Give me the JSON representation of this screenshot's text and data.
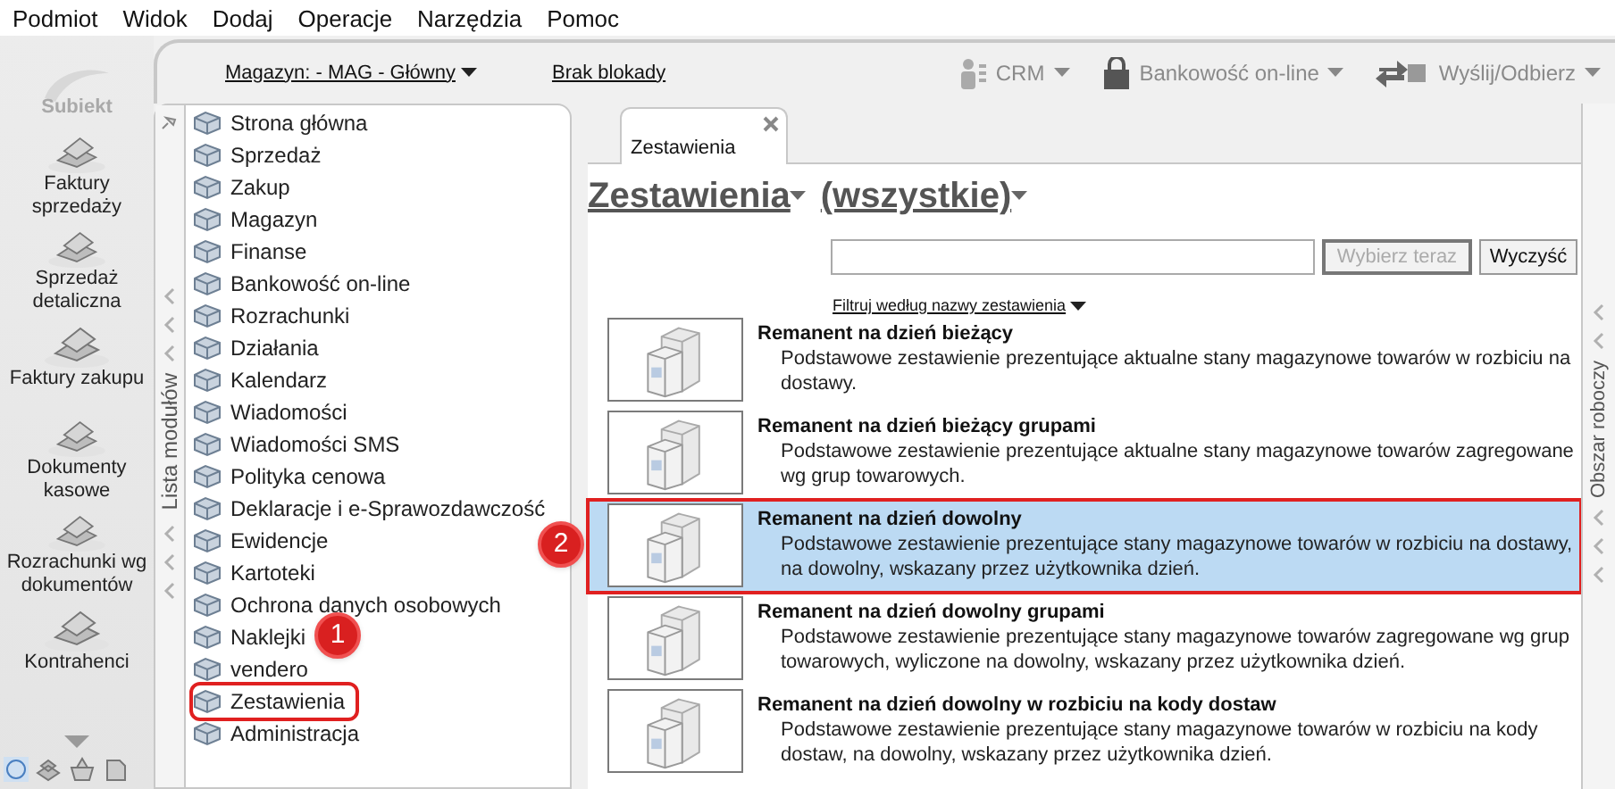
{
  "menu": [
    "Podmiot",
    "Widok",
    "Dodaj",
    "Operacje",
    "Narzędzia",
    "Pomoc"
  ],
  "logo": {
    "name": "Subiekt"
  },
  "nav_items": [
    "Faktury sprzedaży",
    "Sprzedaż detaliczna",
    "Faktury zakupu",
    "Dokumenty kasowe",
    "Rozrachunki wg dokumentów",
    "Kontrahenci"
  ],
  "toolbar": {
    "warehouse": "Magazyn: - MAG - Główny",
    "lock": "Brak blokady",
    "buttons": [
      "CRM",
      "Bankowość on-line",
      "Wyślij/Odbierz"
    ]
  },
  "modules": {
    "title": "Lista modułów",
    "items": [
      {
        "label": "Strona główna",
        "outlined": false
      },
      {
        "label": "Sprzedaż",
        "outlined": false
      },
      {
        "label": "Zakup",
        "outlined": false
      },
      {
        "label": "Magazyn",
        "outlined": false
      },
      {
        "label": "Finanse",
        "outlined": false
      },
      {
        "label": "Bankowość on-line",
        "outlined": false
      },
      {
        "label": "Rozrachunki",
        "outlined": false
      },
      {
        "label": "Działania",
        "outlined": false
      },
      {
        "label": "Kalendarz",
        "outlined": false
      },
      {
        "label": "Wiadomości",
        "outlined": false
      },
      {
        "label": "Wiadomości SMS",
        "outlined": false
      },
      {
        "label": "Polityka cenowa",
        "outlined": false
      },
      {
        "label": "Deklaracje i e-Sprawozdawczość",
        "outlined": false
      },
      {
        "label": "Ewidencje",
        "outlined": false
      },
      {
        "label": "Kartoteki",
        "outlined": false
      },
      {
        "label": "Ochrona danych osobowych",
        "outlined": false
      },
      {
        "label": "Naklejki",
        "outlined": false
      },
      {
        "label": "vendero",
        "outlined": false
      },
      {
        "label": "Zestawienia",
        "outlined": true
      },
      {
        "label": "Administracja",
        "outlined": false
      }
    ]
  },
  "tab": {
    "label": "Zestawienia"
  },
  "heading": [
    "Zestawienia",
    "(wszystkie)"
  ],
  "search": {
    "select_button": "Wybierz teraz",
    "select_disabled": true,
    "clear_button": "Wyczyść",
    "filter_link": "Filtruj według nazwy zestawienia"
  },
  "reports": [
    {
      "title": "Remanent na dzień bieżący",
      "description": "Podstawowe zestawienie prezentujące aktualne stany magazynowe towarów w rozbiciu na dostawy.",
      "selected": false,
      "outlined": false
    },
    {
      "title": "Remanent na dzień bieżący grupami",
      "description": "Podstawowe zestawienie prezentujące aktualne stany magazynowe towarów zagregowane wg grup towarowych.",
      "selected": false,
      "outlined": false
    },
    {
      "title": "Remanent na dzień dowolny",
      "description": "Podstawowe zestawienie prezentujące stany magazynowe towarów w rozbiciu na dostawy, na dowolny, wskazany przez użytkownika dzień.",
      "selected": true,
      "outlined": true
    },
    {
      "title": "Remanent na dzień dowolny grupami",
      "description": "Podstawowe zestawienie prezentujące stany magazynowe towarów zagregowane wg grup towarowych, wyliczone na dowolny, wskazany przez użytkownika dzień.",
      "selected": false,
      "outlined": false
    },
    {
      "title": "Remanent na dzień dowolny w rozbiciu na kody dostaw",
      "description": "Podstawowe zestawienie prezentujące stany magazynowe towarów w rozbiciu na kody dostaw, na dowolny, wskazany przez użytkownika dzień.",
      "selected": false,
      "outlined": false
    }
  ],
  "right_panel": {
    "title": "Obszar roboczy"
  },
  "annotations": [
    {
      "label": "1"
    },
    {
      "label": "2"
    }
  ]
}
